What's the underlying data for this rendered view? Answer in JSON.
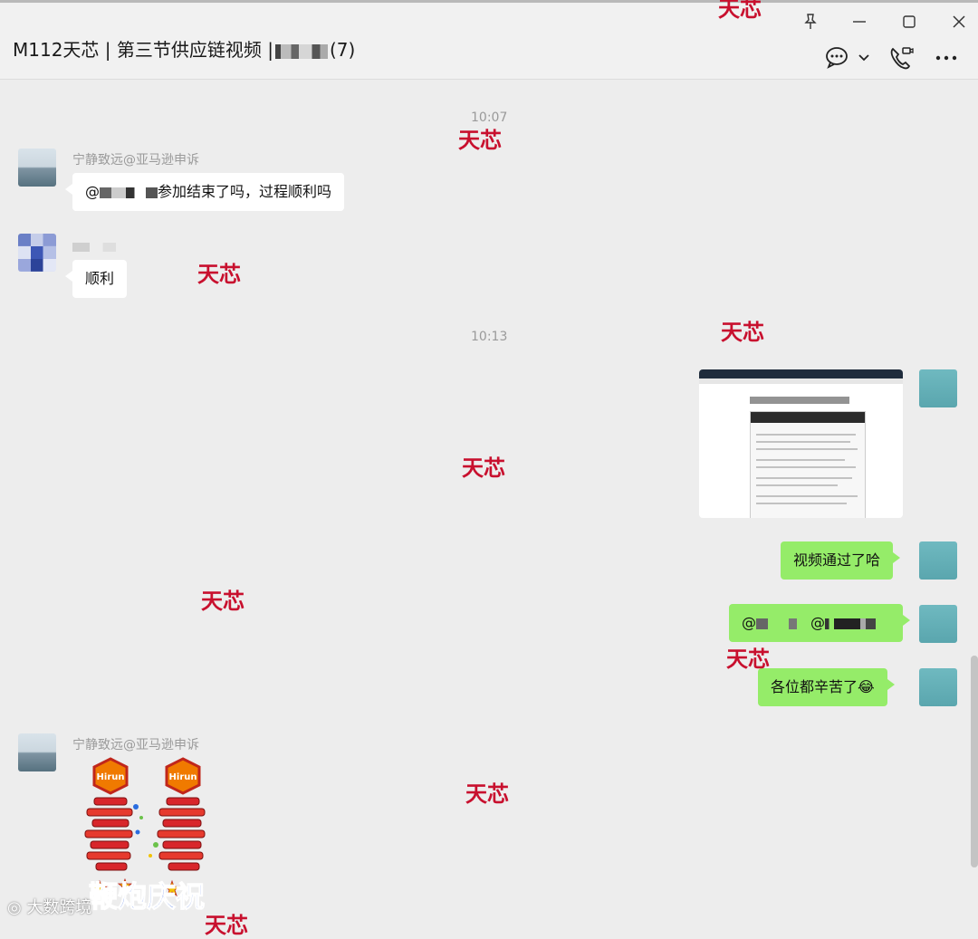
{
  "window": {
    "title_prefix": "M112天芯 | 第三节供应链视频 |",
    "title_suffix": "(7)"
  },
  "chat": {
    "messages": [
      {
        "type": "time",
        "text": "10:07"
      },
      {
        "type": "in",
        "sender": "宁静致远@亚马逊申诉",
        "text_prefix": "@",
        "text_suffix": "参加结束了吗，过程顺利吗"
      },
      {
        "type": "in",
        "sender": "",
        "text": "顺利"
      },
      {
        "type": "time",
        "text": "10:13"
      },
      {
        "type": "out_image",
        "description": "screenshot"
      },
      {
        "type": "out",
        "text": "视频通过了哈"
      },
      {
        "type": "out",
        "text_a": "@",
        "text_b": "@"
      },
      {
        "type": "out",
        "text": "各位都辛苦了😂"
      },
      {
        "type": "in",
        "sender": "宁静致远@亚马逊申诉",
        "sticker_text": "鞭炮庆祝",
        "sticker_badge": "Hirun"
      }
    ]
  },
  "watermarks": {
    "brand": "天芯",
    "source": "大数跨境"
  },
  "icons": {
    "pin": "pin-icon",
    "minimize": "minimize-icon",
    "maximize": "maximize-icon",
    "close": "close-icon",
    "chat_info": "chat-bubble-icon",
    "dropdown": "chevron-down-icon",
    "call": "phone-video-icon",
    "more": "more-icon"
  },
  "colors": {
    "background": "#ededed",
    "outgoing_bubble": "#95ec69",
    "incoming_bubble": "#ffffff",
    "watermark": "#c8102e"
  }
}
